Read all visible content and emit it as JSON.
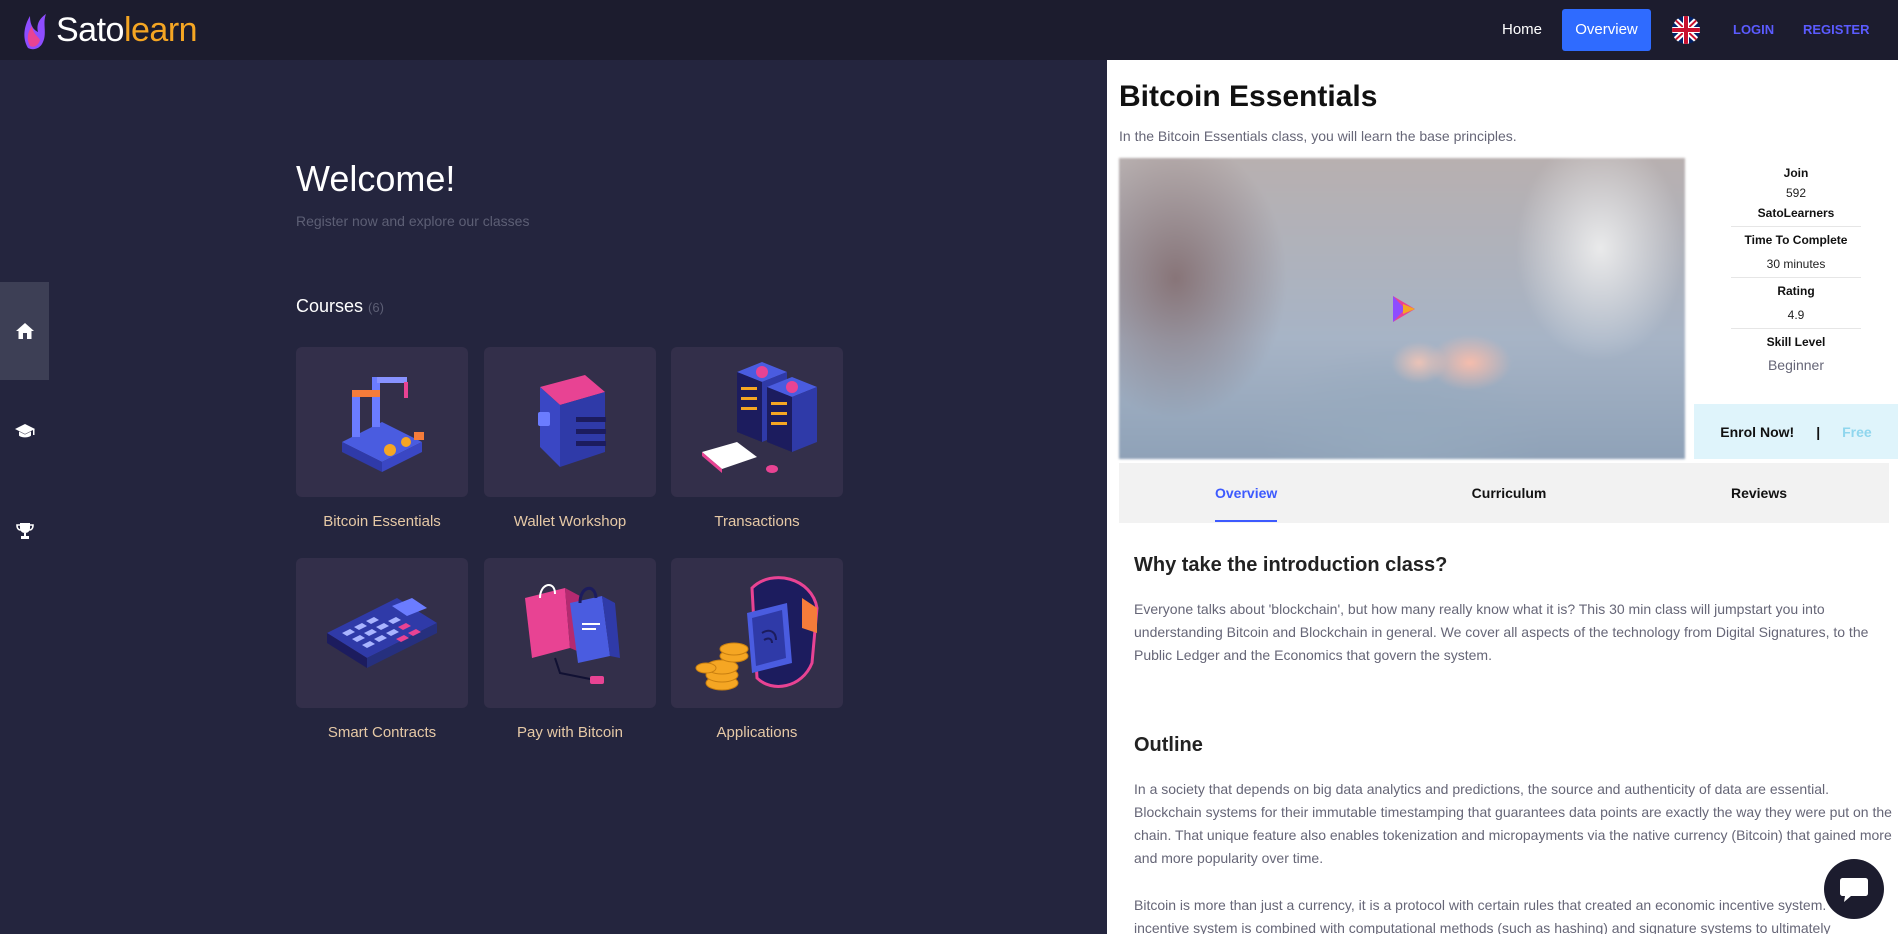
{
  "brand": {
    "part1": "Sato",
    "part2": "learn"
  },
  "nav": {
    "home": "Home",
    "overview": "Overview",
    "login": "LOGIN",
    "register": "REGISTER"
  },
  "sidebar": {
    "items": [
      {
        "icon": "home-icon"
      },
      {
        "icon": "graduation-cap-icon"
      },
      {
        "icon": "trophy-icon"
      }
    ]
  },
  "main": {
    "welcome": "Welcome!",
    "subtitle": "Register now and explore our classes",
    "courses_label": "Courses",
    "courses_count": "(6)",
    "courses": [
      {
        "label": "Bitcoin Essentials",
        "icon": "robot-arm-icon"
      },
      {
        "label": "Wallet Workshop",
        "icon": "wallet-icon"
      },
      {
        "label": "Transactions",
        "icon": "server-rack-icon"
      },
      {
        "label": "Smart Contracts",
        "icon": "calculator-icon"
      },
      {
        "label": "Pay with Bitcoin",
        "icon": "shopping-bags-icon"
      },
      {
        "label": "Applications",
        "icon": "smartwatch-coins-icon"
      }
    ]
  },
  "panel": {
    "title": "Bitcoin Essentials",
    "description": "In the Bitcoin Essentials class, you will learn the base principles.",
    "stats": {
      "join_label": "Join",
      "join_count": "592",
      "join_unit": "SatoLearners",
      "time_label": "Time To Complete",
      "time_value": "30 minutes",
      "rating_label": "Rating",
      "rating_value": "4.9",
      "skill_label": "Skill Level",
      "skill_value": "Beginner"
    },
    "enrol": {
      "label": "Enrol Now!",
      "separator": "|",
      "price": "Free"
    },
    "tabs": [
      "Overview",
      "Curriculum",
      "Reviews"
    ],
    "why_heading": "Why take the introduction class?",
    "why_text": "Everyone talks about 'blockchain', but how many really know what it is? This 30 min class will jumpstart you into understanding Bitcoin and Blockchain in general. We cover all aspects of the technology from Digital Signatures, to the Public Ledger and the Economics that govern the system.",
    "outline_heading": "Outline",
    "outline_p1": "In a society that depends on big data analytics and predictions, the source and authenticity of data are essential. Blockchain systems for their immutable timestamping that guarantees data points are exactly the way they were put on the chain. That unique feature also enables tokenization and micropayments via the native currency (Bitcoin) that gained more and more popularity over time.",
    "outline_p2": "Bitcoin is more than just a currency, it is a protocol with certain rules that created an economic incentive system. The incentive system is combined with computational methods (such as hashing) and signature systems to ultimately"
  },
  "colors": {
    "accent": "#2f6bff",
    "brand_orange": "#f5a623",
    "link": "#5b5bff",
    "tab_active": "#3d5afe"
  }
}
